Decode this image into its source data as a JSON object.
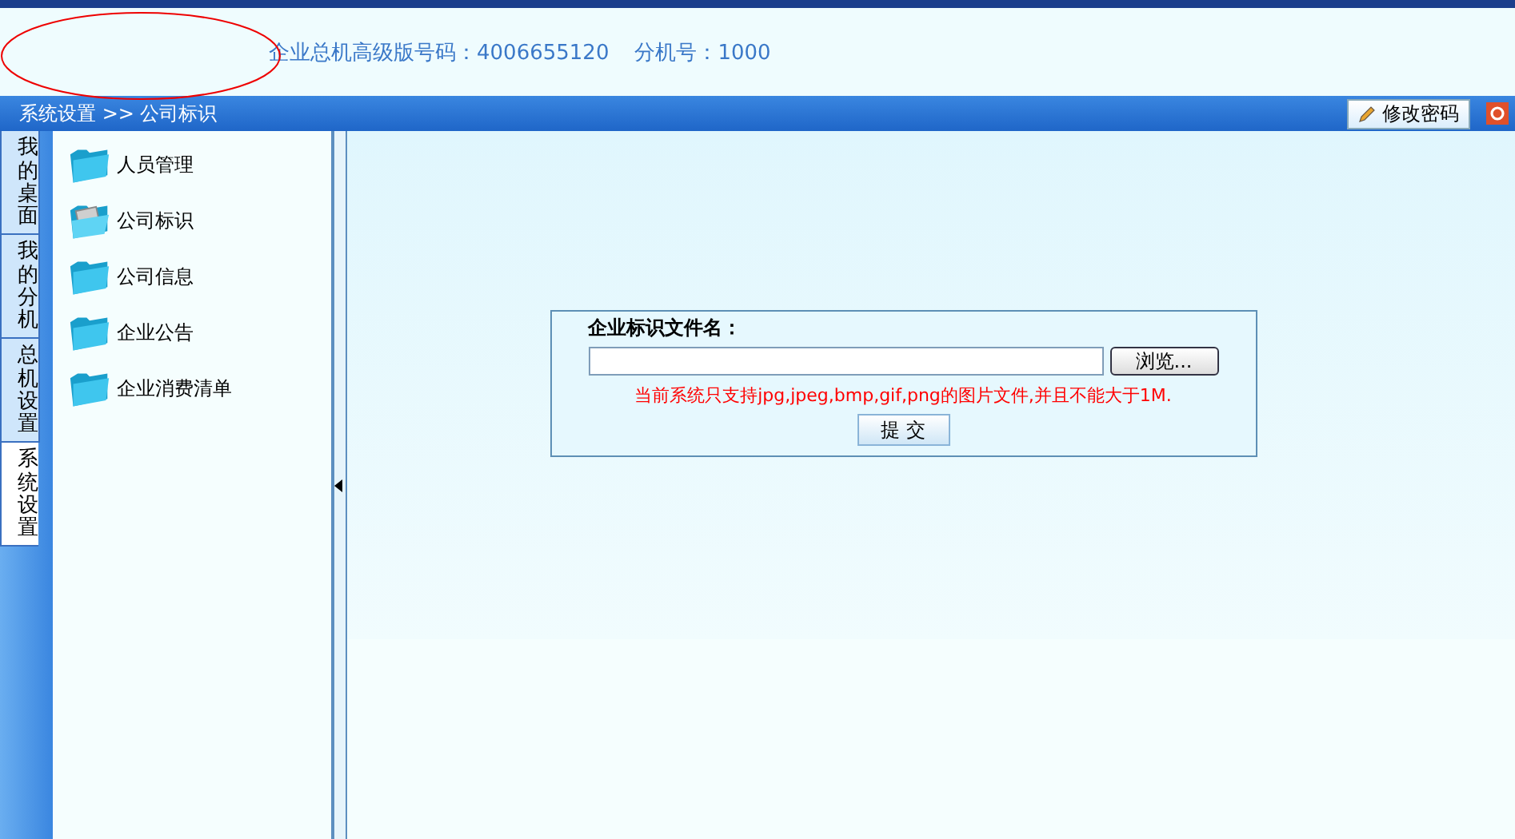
{
  "header": {
    "hotline": "企业总机高级版号码：4006655120",
    "extension": "分机号：1000"
  },
  "nav_bar": {
    "breadcrumb": "系统设置 >> 公司标识",
    "change_password": "修改密码"
  },
  "side_tabs": [
    {
      "label": "我的桌面",
      "selected": false
    },
    {
      "label": "我的分机",
      "selected": false
    },
    {
      "label": "总机设置",
      "selected": false
    },
    {
      "label": "系统设置",
      "selected": true
    }
  ],
  "tree": [
    {
      "label": "人员管理",
      "selected": false
    },
    {
      "label": "公司标识",
      "selected": true
    },
    {
      "label": "公司信息",
      "selected": false
    },
    {
      "label": "企业公告",
      "selected": false
    },
    {
      "label": "企业消费清单",
      "selected": false
    }
  ],
  "form": {
    "label": "企业标识文件名：",
    "browse": "浏览...",
    "notice": "当前系统只支持jpg,jpeg,bmp,gif,png的图片文件,并且不能大于1M.",
    "submit": "提 交"
  }
}
